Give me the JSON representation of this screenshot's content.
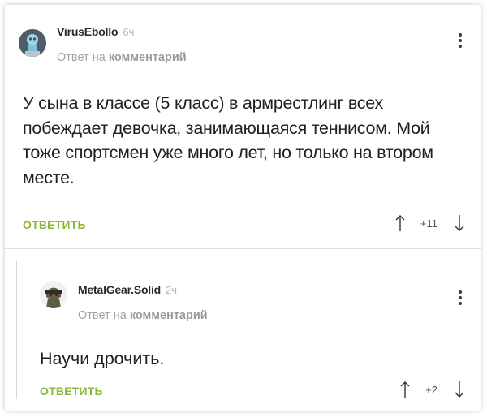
{
  "comments": [
    {
      "author": "VirusEbollo",
      "time": "6ч",
      "reply_prefix": "Ответ на",
      "reply_target": "комментарий",
      "text": "У сына в классе (5 класс) в армрестлинг всех побеждает девочка, занимающаяся теннисом. Мой тоже спортсмен уже много лет, но только на втором месте.",
      "reply_label": "ОТВЕТИТЬ",
      "score": "+11"
    },
    {
      "author": "MetalGear.Solid",
      "time": "2ч",
      "reply_prefix": "Ответ на",
      "reply_target": "комментарий",
      "text": "Научи дрочить.",
      "reply_label": "ОТВЕТИТЬ",
      "score": "+2"
    }
  ],
  "colors": {
    "accent_green": "#8ab83c",
    "muted_gray": "#a3a3a3"
  },
  "icons": [
    "avatar-robot",
    "avatar-soldier",
    "kebab-menu-icon",
    "arrow-up-icon",
    "arrow-down-icon"
  ]
}
